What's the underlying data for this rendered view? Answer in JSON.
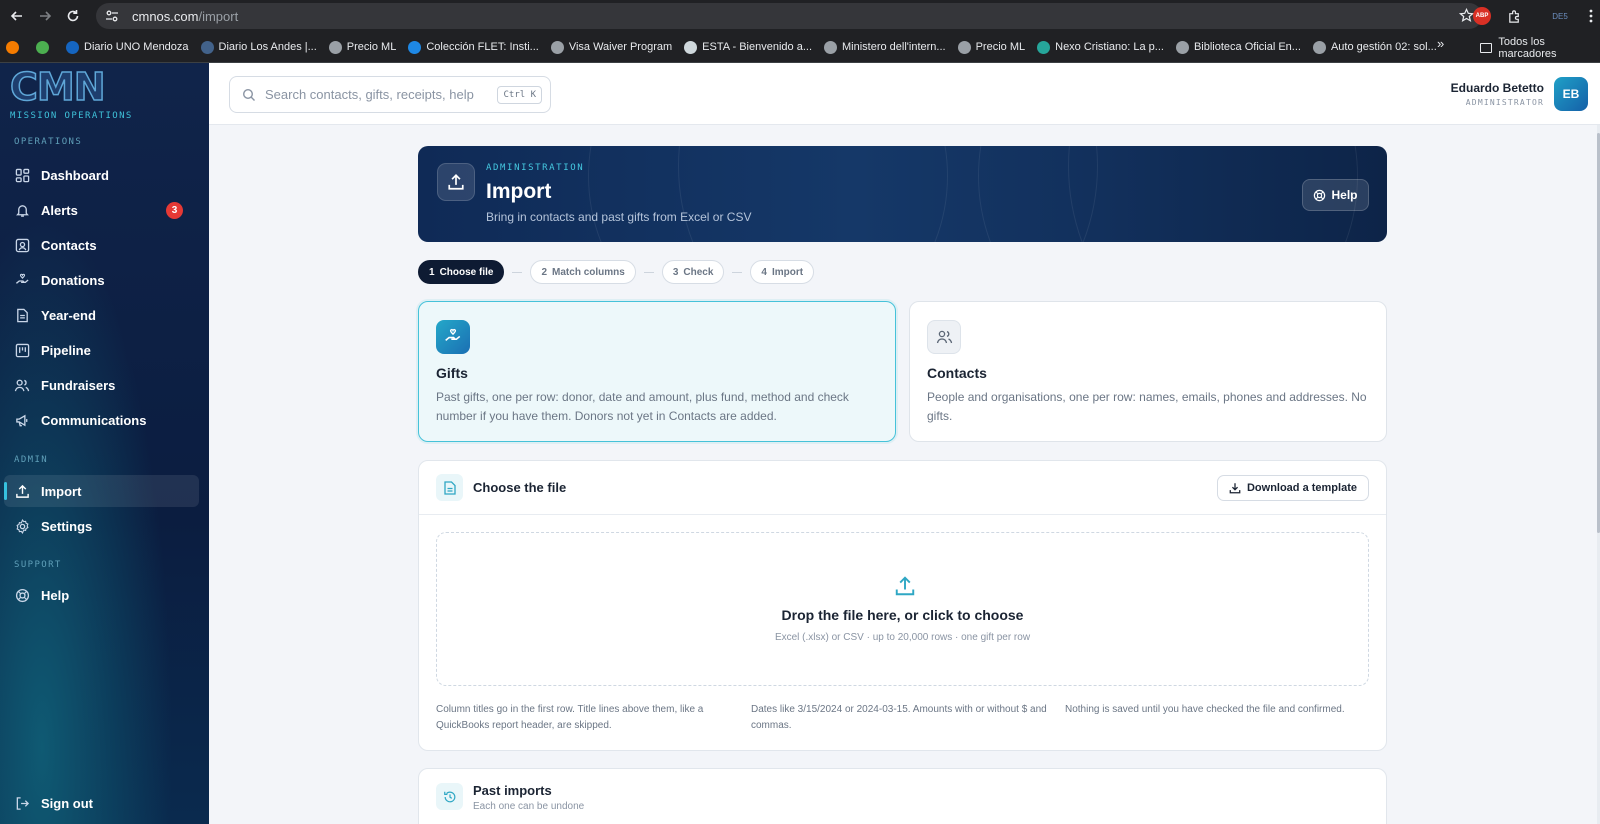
{
  "browser": {
    "url_host": "cmnos.com",
    "url_path": "/import",
    "bookmarks": [
      {
        "label": "",
        "color": "#f57c00"
      },
      {
        "label": "",
        "color": "#4caf50"
      },
      {
        "label": "Diario UNO Mendoza",
        "color": "#1565c0"
      },
      {
        "label": "Diario Los Andes |...",
        "color": "#42628a"
      },
      {
        "label": "Precio ML",
        "color": "#9aa0a6"
      },
      {
        "label": "Colección FLET: Insti...",
        "color": "#1e88e5"
      },
      {
        "label": "Visa Waiver Program",
        "color": "#9aa0a6"
      },
      {
        "label": "ESTA - Bienvenido a...",
        "color": "#cfd8dc"
      },
      {
        "label": "Ministero dell'intern...",
        "color": "#9aa0a6"
      },
      {
        "label": "Precio ML",
        "color": "#9aa0a6"
      },
      {
        "label": "Nexo Cristiano: La p...",
        "color": "#26a69a"
      },
      {
        "label": "Biblioteca Oficial En...",
        "color": "#9aa0a6"
      },
      {
        "label": "Auto gestión 02: sol...",
        "color": "#9aa0a6"
      }
    ],
    "bookmarks_more": "»",
    "all_bookmarks": "Todos los marcadores",
    "ext_abp": "ABP",
    "ext_profile": "DE5"
  },
  "brand": {
    "logo_letters": [
      "C",
      "M",
      "N"
    ],
    "logo_sub": "MISSION OPERATIONS"
  },
  "sidebar": {
    "section_operations": "OPERATIONS",
    "section_admin": "ADMIN",
    "section_support": "SUPPORT",
    "items": [
      {
        "label": "Dashboard",
        "icon": "dashboard-icon"
      },
      {
        "label": "Alerts",
        "icon": "bell-icon",
        "badge": "3"
      },
      {
        "label": "Contacts",
        "icon": "contact-card-icon"
      },
      {
        "label": "Donations",
        "icon": "hand-heart-icon"
      },
      {
        "label": "Year-end",
        "icon": "document-icon"
      },
      {
        "label": "Pipeline",
        "icon": "kanban-icon"
      },
      {
        "label": "Fundraisers",
        "icon": "users-icon"
      },
      {
        "label": "Communications",
        "icon": "megaphone-icon"
      },
      {
        "label": "Import",
        "icon": "upload-icon",
        "active": true
      },
      {
        "label": "Settings",
        "icon": "gear-icon"
      },
      {
        "label": "Help",
        "icon": "lifebuoy-icon"
      },
      {
        "label": "Sign out",
        "icon": "sign-out-icon"
      }
    ]
  },
  "topbar": {
    "search_placeholder": "Search contacts, gifts, receipts, help",
    "search_shortcut": "Ctrl K",
    "user_name": "Eduardo Betetto",
    "user_role": "ADMINISTRATOR",
    "user_initials": "EB"
  },
  "hero": {
    "eyebrow": "ADMINISTRATION",
    "title": "Import",
    "subtitle": "Bring in contacts and past gifts from Excel or CSV",
    "help_label": "Help"
  },
  "steps": [
    {
      "num": "1",
      "label": "Choose file",
      "active": true
    },
    {
      "num": "2",
      "label": "Match columns"
    },
    {
      "num": "3",
      "label": "Check"
    },
    {
      "num": "4",
      "label": "Import"
    }
  ],
  "types": {
    "gifts": {
      "title": "Gifts",
      "description": "Past gifts, one per row: donor, date and amount, plus fund, method and check number if you have them. Donors not yet in Contacts are added."
    },
    "contacts": {
      "title": "Contacts",
      "description": "People and organisations, one per row: names, emails, phones and addresses. No gifts."
    }
  },
  "file_panel": {
    "title": "Choose the file",
    "download_label": "Download a template",
    "drop_title": "Drop the file here, or click to choose",
    "drop_sub": "Excel (.xlsx) or CSV · up to 20,000 rows · one gift per row",
    "notes": [
      "Column titles go in the first row. Title lines above them, like a QuickBooks report header, are skipped.",
      "Dates like 3/15/2024 or 2024-03-15. Amounts with or without $ and commas.",
      "Nothing is saved until you have checked the file and confirmed."
    ]
  },
  "past_imports": {
    "title": "Past imports",
    "subtitle": "Each one can be undone"
  },
  "colors": {
    "accent": "#36c1df",
    "sidebar_bg": "#0b1d40",
    "hero_bg": "#153868",
    "alert_badge": "#e53935"
  }
}
